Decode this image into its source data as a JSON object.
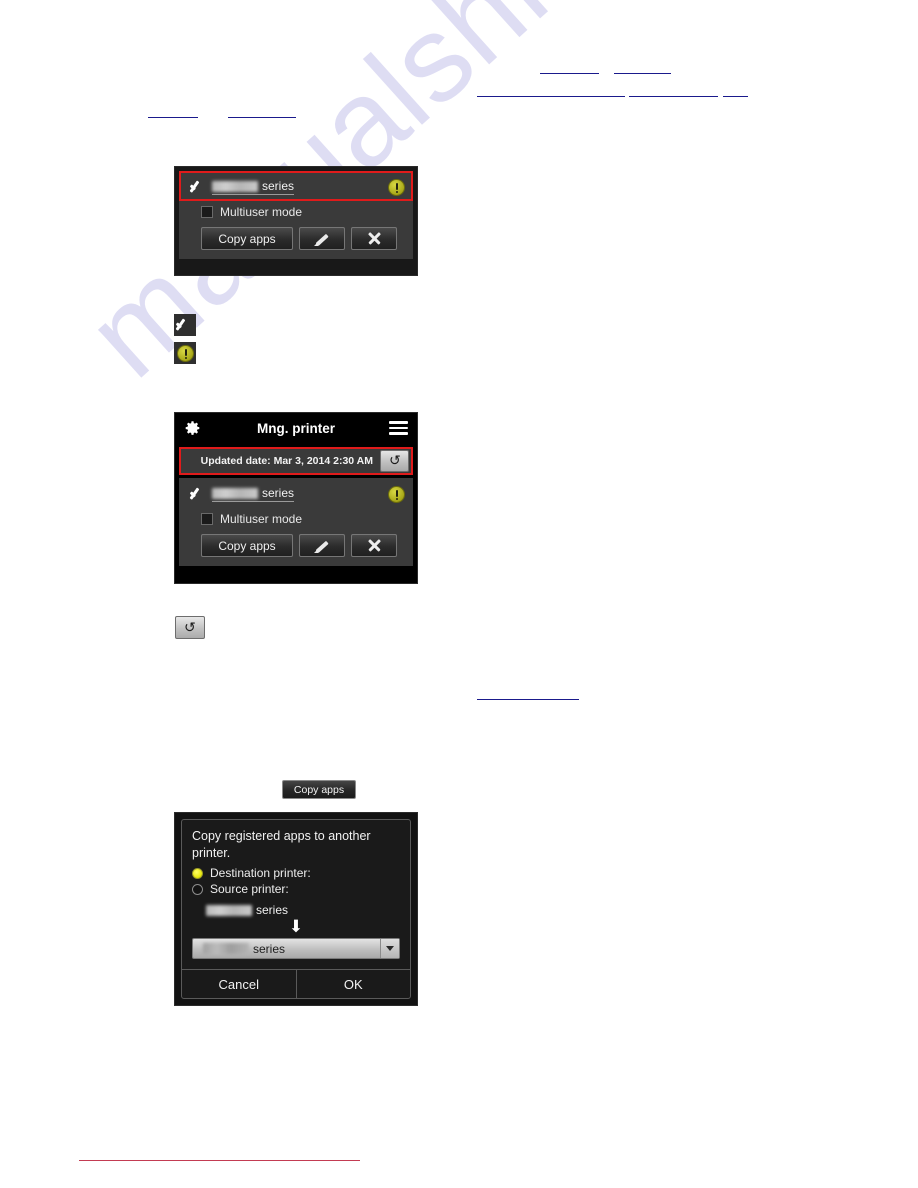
{
  "watermark": {
    "text": "manualshive.com"
  },
  "links": [
    {
      "name": "link-rule-1"
    },
    {
      "name": "link-rule-2"
    },
    {
      "name": "link-rule-3"
    },
    {
      "name": "link-rule-4"
    },
    {
      "name": "link-rule-5"
    },
    {
      "name": "link-rule-6"
    },
    {
      "name": "link-rule-7"
    },
    {
      "name": "link-rule-8"
    }
  ],
  "printer_panel_1": {
    "series_label": "series",
    "multiuser_label": "Multiuser mode",
    "copy_apps_label": "Copy apps",
    "edit_icon": "pencil-icon",
    "delete_icon": "close-icon",
    "status_icon": "warning-icon",
    "selected_icon": "check-icon",
    "highlight_color": "#e01b1b"
  },
  "legend_icons": {
    "check": "check-icon",
    "warning": "warning-icon"
  },
  "printer_panel_2": {
    "header": {
      "gear_icon": "gear-icon",
      "title": "Mng. printer",
      "menu_icon": "hamburger-icon"
    },
    "updated": {
      "text": "Updated date: Mar 3, 2014 2:30 AM",
      "refresh_icon": "refresh-icon",
      "highlight_color": "#e01b1b"
    },
    "series_label": "series",
    "multiuser_label": "Multiuser mode",
    "copy_apps_label": "Copy apps",
    "edit_icon": "pencil-icon",
    "delete_icon": "close-icon",
    "status_icon": "warning-icon"
  },
  "standalone_refresh": {
    "icon": "refresh-icon"
  },
  "standalone_copy_apps": {
    "label": "Copy apps"
  },
  "copy_dialog": {
    "title": "Copy registered apps to another printer.",
    "destination_label": "Destination printer:",
    "source_label": "Source printer:",
    "source_series": "series",
    "arrow_glyph": "⬇",
    "dropdown_value": "series",
    "dropdown_caret": "chevron-down-icon",
    "cancel_label": "Cancel",
    "ok_label": "OK"
  },
  "colors": {
    "panel_bg": "#3a3a3a",
    "frame_bg": "#181818",
    "accent_red": "#e01b1b",
    "warning_yellow": "#b8b820",
    "link_blue": "#1a1a8c",
    "footer_rule": "#c33b52",
    "watermark": "#d9d8f2"
  }
}
